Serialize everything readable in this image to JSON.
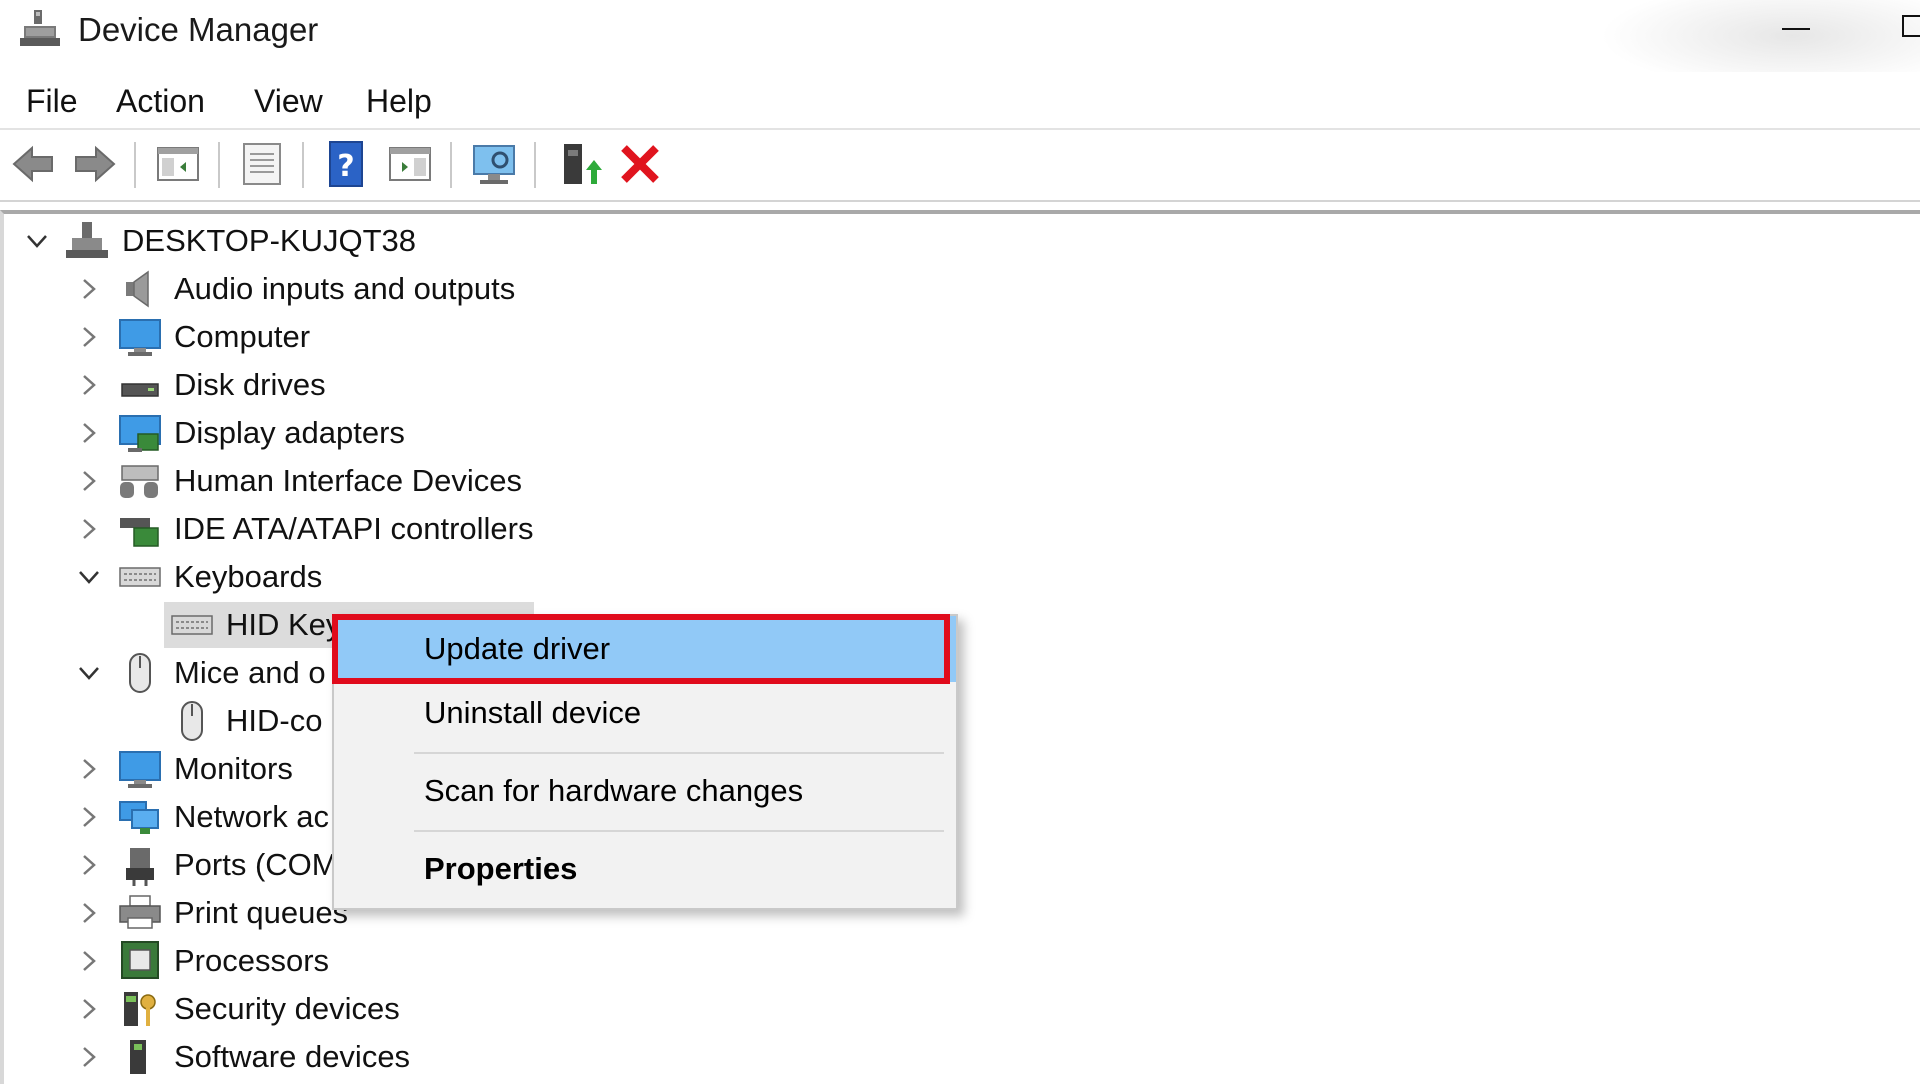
{
  "window": {
    "title": "Device Manager",
    "app_icon": "device-manager-icon"
  },
  "menubar": {
    "items": [
      "File",
      "Action",
      "View",
      "Help"
    ]
  },
  "toolbar": {
    "buttons": [
      "back-arrow-icon",
      "forward-arrow-icon",
      "show-hide-console-tree-icon",
      "properties-icon",
      "help-icon",
      "action-pane-icon",
      "scan-hardware-icon",
      "update-driver-icon",
      "uninstall-device-icon"
    ]
  },
  "tree": {
    "root": "DESKTOP-KUJQT38",
    "nodes": [
      {
        "label": "Audio inputs and outputs",
        "icon": "speaker-icon",
        "expanded": false
      },
      {
        "label": "Computer",
        "icon": "monitor-icon",
        "expanded": false
      },
      {
        "label": "Disk drives",
        "icon": "disk-drive-icon",
        "expanded": false
      },
      {
        "label": "Display adapters",
        "icon": "display-adapter-icon",
        "expanded": false
      },
      {
        "label": "Human Interface Devices",
        "icon": "hid-icon",
        "expanded": false
      },
      {
        "label": "IDE ATA/ATAPI controllers",
        "icon": "ide-controller-icon",
        "expanded": false
      },
      {
        "label": "Keyboards",
        "icon": "keyboard-icon",
        "expanded": true
      },
      {
        "label": "HID Key",
        "icon": "keyboard-icon",
        "child": true
      },
      {
        "label": "Mice and o",
        "icon": "mouse-icon",
        "expanded": true
      },
      {
        "label": "HID-co",
        "icon": "mouse-icon",
        "child": true
      },
      {
        "label": "Monitors",
        "icon": "monitor-icon",
        "expanded": false
      },
      {
        "label": "Network ac",
        "icon": "network-adapter-icon",
        "expanded": false
      },
      {
        "label": "Ports (COM",
        "icon": "port-icon",
        "expanded": false
      },
      {
        "label": "Print queues",
        "icon": "printer-icon",
        "expanded": false
      },
      {
        "label": "Processors",
        "icon": "processor-icon",
        "expanded": false
      },
      {
        "label": "Security devices",
        "icon": "security-device-icon",
        "expanded": false
      },
      {
        "label": "Software devices",
        "icon": "software-device-icon",
        "expanded": false
      }
    ]
  },
  "context_menu": {
    "items": [
      {
        "label": "Update driver",
        "highlighted": true,
        "bold": false
      },
      {
        "label": "Uninstall device",
        "highlighted": false,
        "bold": false
      },
      {
        "label": "Scan for hardware changes",
        "highlighted": false,
        "bold": false
      },
      {
        "label": "Properties",
        "highlighted": false,
        "bold": true
      }
    ],
    "highlight_color": "#91c9f7",
    "callout_color": "#e00b1c"
  }
}
